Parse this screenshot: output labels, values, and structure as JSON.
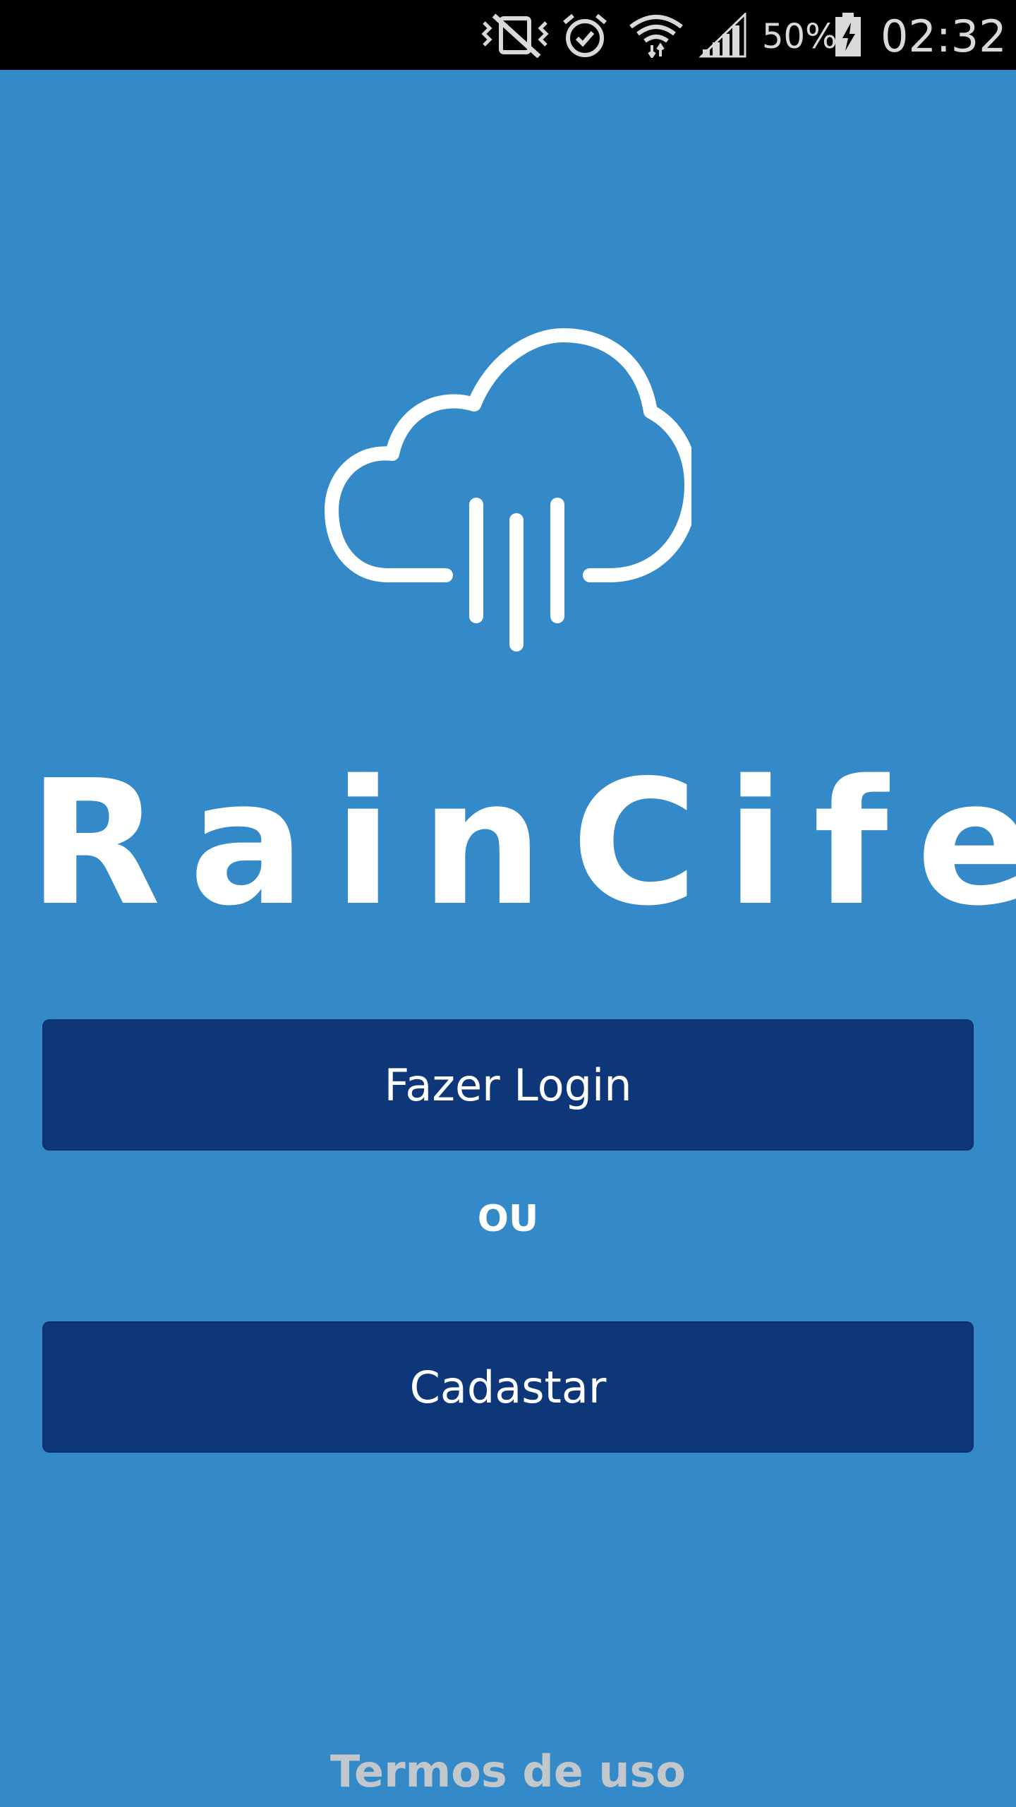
{
  "status_bar": {
    "icons": [
      "vibrate-off-icon",
      "alarm-icon",
      "wifi-icon",
      "signal-icon",
      "battery-charging-icon"
    ],
    "battery_percent": "50%",
    "time": "02:32"
  },
  "app": {
    "logo_icon": "cloud-rain-icon",
    "name": "RainCife"
  },
  "actions": {
    "login_label": "Fazer Login",
    "or_label": "OU",
    "register_label": "Cadastar"
  },
  "footer": {
    "terms_label": "Termos de uso"
  },
  "colors": {
    "background": "#3489C9",
    "button": "#0E377A",
    "status_bar": "#000000",
    "terms_text": "#C2C7CC"
  }
}
